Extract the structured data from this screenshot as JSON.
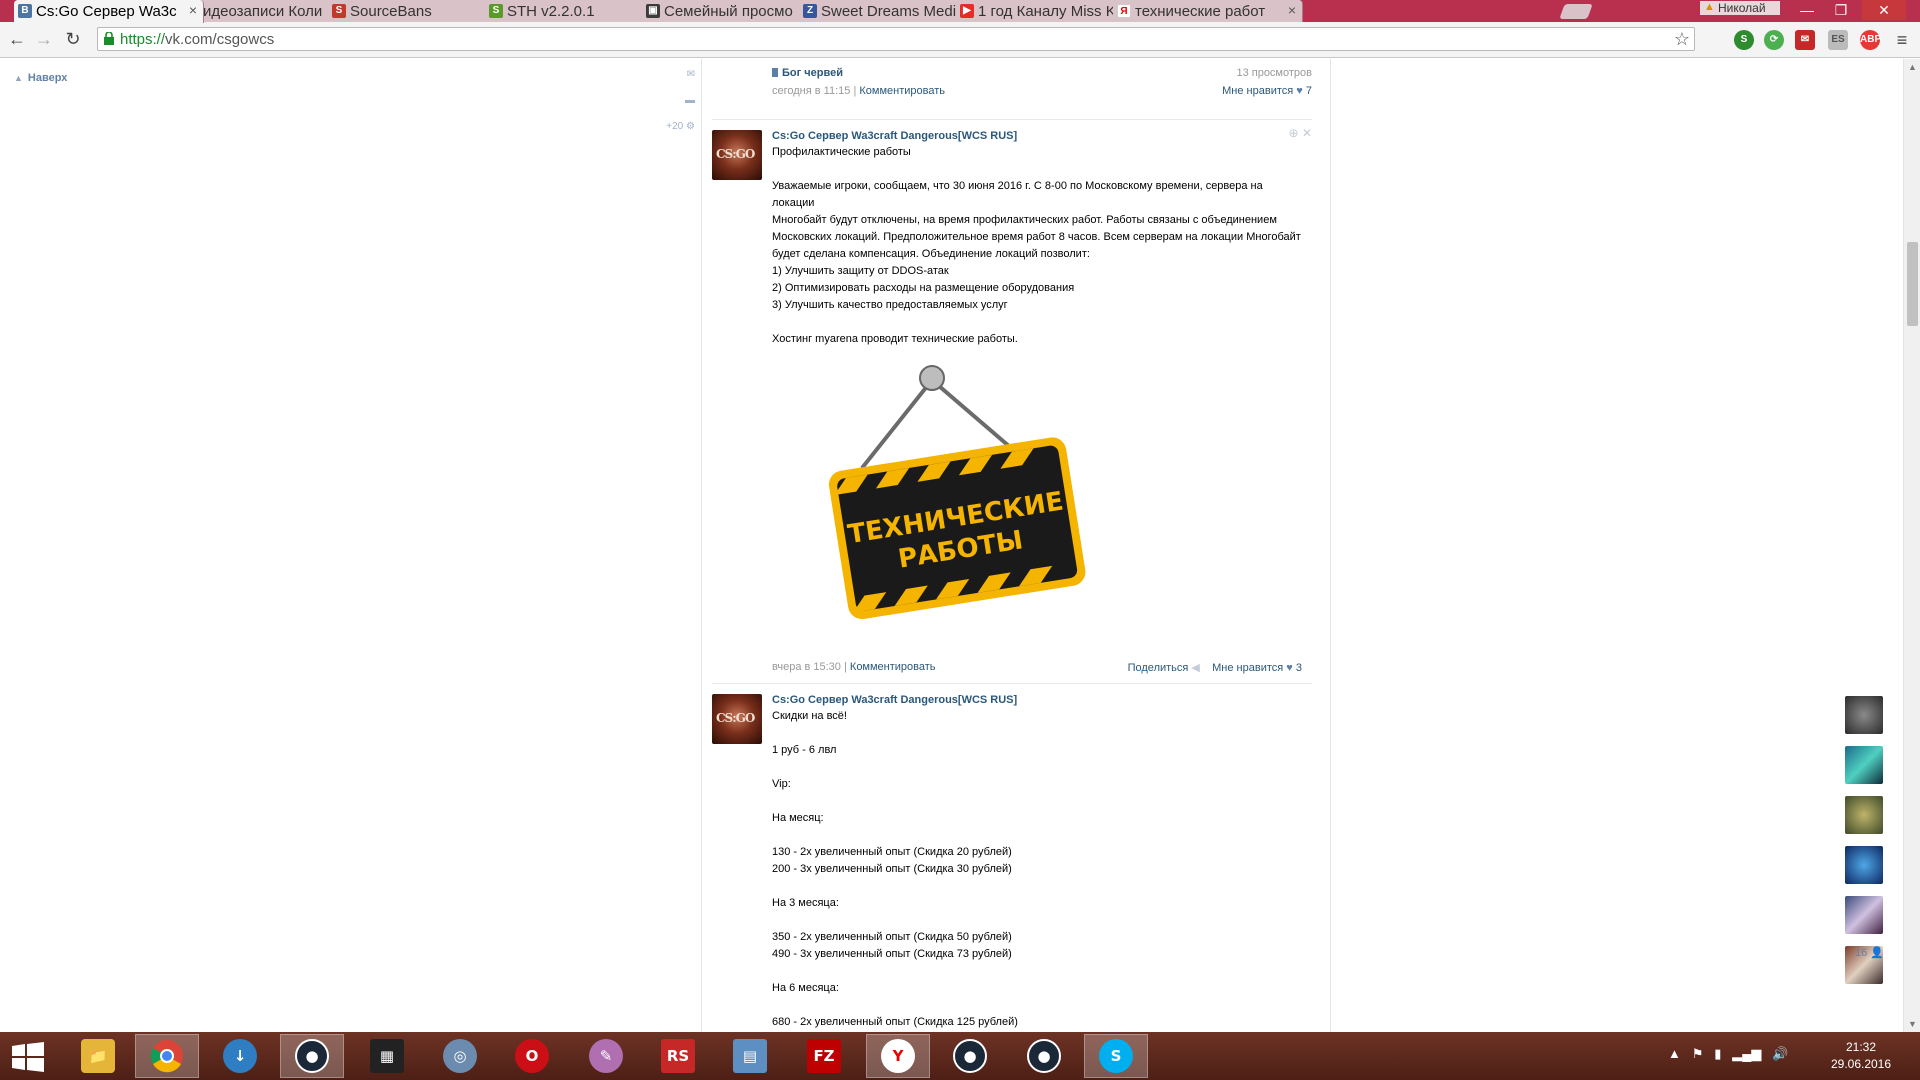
{
  "browser": {
    "tabs": [
      {
        "title": "Cs:Go Сервер Wa3c",
        "favicon": "vk-icon",
        "color": "#4c75a3",
        "glyph": "В",
        "active": true
      },
      {
        "title": "Видеозаписи Коли",
        "favicon": "vk-icon",
        "color": "#4c75a3",
        "glyph": "В",
        "active": false
      },
      {
        "title": "SourceBans",
        "favicon": "sourcebans-icon",
        "color": "#c0392b",
        "glyph": "S",
        "active": false
      },
      {
        "title": "STH v2.2.0.1",
        "favicon": "sth-icon",
        "color": "#5a9a2a",
        "glyph": "S",
        "active": false
      },
      {
        "title": "Семейный просмо",
        "favicon": "steam-family-icon",
        "color": "#3b3b3b",
        "glyph": "▣",
        "active": false
      },
      {
        "title": "Sweet Dreams Medi",
        "favicon": "sdm-icon",
        "color": "#3557a0",
        "glyph": "Z",
        "active": false
      },
      {
        "title": "1 год Каналу Miss K",
        "favicon": "youtube-icon",
        "color": "#e52d27",
        "glyph": "▶",
        "active": false
      },
      {
        "title": "технические работ",
        "favicon": "yandex-icon",
        "color": "#ffffff",
        "glyph": "Я",
        "active": false
      }
    ],
    "user": "Николай",
    "url_scheme": "https://",
    "url_rest": "vk.com/csgowcs"
  },
  "sidebar": {
    "up_label": "Наверх",
    "counter": "+20"
  },
  "wall": {
    "prev_post": {
      "video_title": "Бог червей",
      "views": "13 просмотров",
      "time": "сегодня в 11:15",
      "comment": "Комментировать",
      "like_label": "Мне нравится",
      "like_count": "7"
    },
    "post1": {
      "author": "Cs:Go Сервер Wa3craft Dangerous[WCS RUS]",
      "lines": [
        "Профилактические работы",
        "",
        "Уважаемые игроки, сообщаем, что 30 июня 2016 г. С 8-00 по Московскому времени, сервера на локации",
        "Многобайт будут отключены, на время профилактических работ. Работы связаны с объединением",
        "Московских локаций. Предположительное время работ 8 часов. Всем серверам на локации Многобайт",
        "будет сделана компенсация. Объединение локаций позволит:",
        "1) Улучшить защиту от DDOS-атак",
        "2) Оптимизировать расходы на размещение оборудования",
        "3) Улучшить качество предоставляемых услуг",
        "",
        "Хостинг myarena проводит технические работы."
      ],
      "sign_line1": "ТЕХНИЧЕСКИЕ",
      "sign_line2": "РАБОТЫ",
      "time": "вчера в 15:30",
      "comment": "Комментировать",
      "share": "Поделиться",
      "like_label": "Мне нравится",
      "like_count": "3"
    },
    "post2": {
      "author": "Cs:Go Сервер Wa3craft Dangerous[WCS RUS]",
      "lines": [
        "Скидки на всё!",
        "",
        "1 руб - 6 лвл",
        "",
        "Vip:",
        "",
        "На месяц:",
        "",
        "130 - 2х увеличенный опыт (Скидка 20 рублей)",
        "200 - 3х увеличенный опыт (Скидка 30 рублей)",
        "",
        "На 3 месяца:",
        "",
        "350 - 2х увеличенный опыт (Скидка 50 рублей)",
        "490 - 3х увеличенный опыт (Скидка 73 рублей)",
        "",
        "На 6 месяца:",
        "",
        "680 - 2х увеличенный опыт (Скидка 125 рублей)"
      ]
    }
  },
  "friends": {
    "count": "16"
  },
  "taskbar": {
    "apps": [
      {
        "name": "explorer",
        "glyph": "",
        "color": "#e5b53a"
      },
      {
        "name": "chrome",
        "glyph": "",
        "color": "#4285f4"
      },
      {
        "name": "utorrent",
        "glyph": "↓",
        "color": "#2f7dc2"
      },
      {
        "name": "steam",
        "glyph": "●",
        "color": "#1b2838"
      },
      {
        "name": "video",
        "glyph": "▦",
        "color": "#222222"
      },
      {
        "name": "cd-burner",
        "glyph": "◎",
        "color": "#6b8cae"
      },
      {
        "name": "opera",
        "glyph": "O",
        "color": "#cc0f16"
      },
      {
        "name": "paint",
        "glyph": "✎",
        "color": "#b06fb0"
      },
      {
        "name": "rs",
        "glyph": "RS",
        "color": "#c62828"
      },
      {
        "name": "network-config",
        "glyph": "▤",
        "color": "#5e8fc2"
      },
      {
        "name": "filezilla",
        "glyph": "FZ",
        "color": "#bf0000"
      },
      {
        "name": "yandex",
        "glyph": "Y",
        "color": "#ffffff"
      },
      {
        "name": "steam2",
        "glyph": "●",
        "color": "#1b2838"
      },
      {
        "name": "steam3",
        "glyph": "●",
        "color": "#1b2838"
      },
      {
        "name": "skype",
        "glyph": "S",
        "color": "#00aff0"
      }
    ],
    "time": "21:32",
    "date": "29.06.2016"
  }
}
